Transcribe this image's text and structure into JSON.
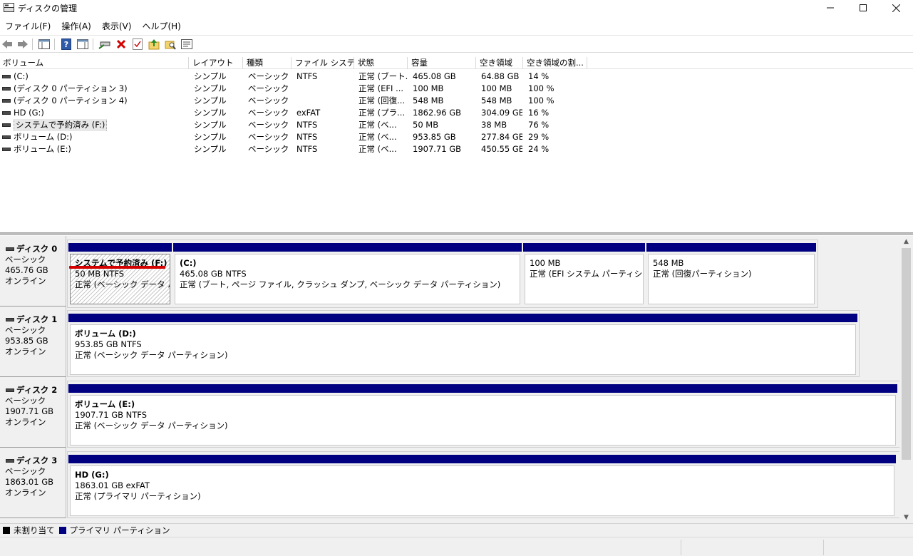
{
  "window": {
    "title": "ディスクの管理"
  },
  "menu": [
    "ファイル(F)",
    "操作(A)",
    "表示(V)",
    "ヘルプ(H)"
  ],
  "toolbar_icons": [
    "back-arrow-icon",
    "forward-arrow-icon",
    "console-tree-icon",
    "help-icon",
    "action-pane-icon",
    "connect-drive-icon",
    "delete-icon",
    "check-icon",
    "up-folder-icon",
    "search-folder-icon",
    "properties-icon"
  ],
  "volume_list": {
    "columns": [
      "ボリューム",
      "レイアウト",
      "種類",
      "ファイル システム",
      "状態",
      "容量",
      "空き領域",
      "空き領域の割..."
    ],
    "rows": [
      {
        "name": "(C:)",
        "layout": "シンプル",
        "type": "ベーシック",
        "fs": "NTFS",
        "status": "正常 (ブート...",
        "capacity": "465.08 GB",
        "free": "64.88 GB",
        "pct": "14 %"
      },
      {
        "name": "(ディスク 0 パーティション 3)",
        "layout": "シンプル",
        "type": "ベーシック",
        "fs": "",
        "status": "正常 (EFI ...",
        "capacity": "100 MB",
        "free": "100 MB",
        "pct": "100 %"
      },
      {
        "name": "(ディスク 0 パーティション 4)",
        "layout": "シンプル",
        "type": "ベーシック",
        "fs": "",
        "status": "正常 (回復...",
        "capacity": "548 MB",
        "free": "548 MB",
        "pct": "100 %"
      },
      {
        "name": "HD (G:)",
        "layout": "シンプル",
        "type": "ベーシック",
        "fs": "exFAT",
        "status": "正常 (プラ...",
        "capacity": "1862.96 GB",
        "free": "304.09 GB",
        "pct": "16 %"
      },
      {
        "name": "システムで予約済み (F:)",
        "layout": "シンプル",
        "type": "ベーシック",
        "fs": "NTFS",
        "status": "正常 (ベ...",
        "capacity": "50 MB",
        "free": "38 MB",
        "pct": "76 %"
      },
      {
        "name": "ボリューム (D:)",
        "layout": "シンプル",
        "type": "ベーシック",
        "fs": "NTFS",
        "status": "正常 (ベ...",
        "capacity": "953.85 GB",
        "free": "277.84 GB",
        "pct": "29 %"
      },
      {
        "name": "ボリューム (E:)",
        "layout": "シンプル",
        "type": "ベーシック",
        "fs": "NTFS",
        "status": "正常 (ベ...",
        "capacity": "1907.71 GB",
        "free": "450.55 GB",
        "pct": "24 %"
      }
    ]
  },
  "disks": [
    {
      "name": "ディスク 0",
      "type": "ベーシック",
      "size": "465.76 GB",
      "state": "オンライン",
      "partitions": [
        {
          "name": "システムで予約済み  (F:)",
          "size_fs": "50 MB NTFS",
          "status": "正常 (ベーシック データ パーティション)",
          "selected": true
        },
        {
          "name": "(C:)",
          "size_fs": "465.08 GB NTFS",
          "status": "正常 (ブート, ページ ファイル, クラッシュ ダンプ, ベーシック データ パーティション)"
        },
        {
          "name": "",
          "size_fs": "100 MB",
          "status": "正常 (EFI システム パーティション)"
        },
        {
          "name": "",
          "size_fs": "548 MB",
          "status": "正常 (回復パーティション)"
        }
      ]
    },
    {
      "name": "ディスク 1",
      "type": "ベーシック",
      "size": "953.85 GB",
      "state": "オンライン",
      "partitions": [
        {
          "name": "ボリューム  (D:)",
          "size_fs": "953.85 GB NTFS",
          "status": "正常 (ベーシック データ パーティション)"
        }
      ]
    },
    {
      "name": "ディスク 2",
      "type": "ベーシック",
      "size": "1907.71 GB",
      "state": "オンライン",
      "partitions": [
        {
          "name": "ボリューム  (E:)",
          "size_fs": "1907.71 GB NTFS",
          "status": "正常 (ベーシック データ パーティション)"
        }
      ]
    },
    {
      "name": "ディスク 3",
      "type": "ベーシック",
      "size": "1863.01 GB",
      "state": "オンライン",
      "partitions": [
        {
          "name": "HD  (G:)",
          "size_fs": "1863.01 GB exFAT",
          "status": "正常 (プライマリ パーティション)"
        }
      ]
    }
  ],
  "legend": [
    {
      "label": "未割り当て",
      "color": "#000000"
    },
    {
      "label": "プライマリ パーティション",
      "color": "#000080"
    }
  ],
  "colors": {
    "partition_bar": "#000080",
    "highlight_underline": "#d40000"
  }
}
